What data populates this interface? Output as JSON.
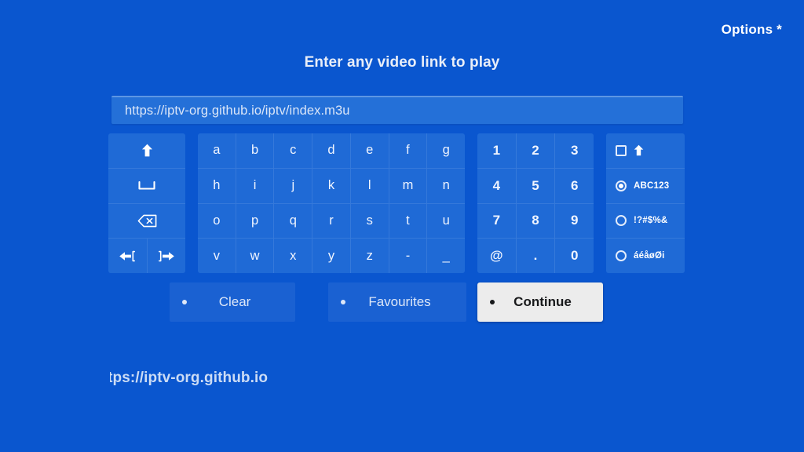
{
  "header": {
    "options_label": "Options *"
  },
  "main": {
    "title": "Enter any video link to play",
    "url_field": {
      "value": "https://iptv-org.github.io/iptv/index.m3u",
      "placeholder": "Enter any video link to play"
    }
  },
  "keyboard": {
    "function_keys": [
      {
        "name": "shift-key",
        "icon": "arrow-up-icon",
        "label": ""
      },
      {
        "name": "space-key",
        "icon": "space-bar-icon",
        "label": ""
      },
      {
        "name": "backspace-key",
        "icon": "backspace-icon",
        "label": ""
      },
      {
        "name": "cursor-left-key",
        "icon": "arrow-left-bracket-icon",
        "label": ""
      },
      {
        "name": "cursor-right-key",
        "icon": "bracket-arrow-right-icon",
        "label": ""
      }
    ],
    "letter_rows": [
      [
        "a",
        "b",
        "c",
        "d",
        "e",
        "f",
        "g"
      ],
      [
        "h",
        "i",
        "j",
        "k",
        "l",
        "m",
        "n"
      ],
      [
        "o",
        "p",
        "q",
        "r",
        "s",
        "t",
        "u"
      ],
      [
        "v",
        "w",
        "x",
        "y",
        "z",
        "-",
        "_"
      ]
    ],
    "digit_rows": [
      [
        "1",
        "2",
        "3"
      ],
      [
        "4",
        "5",
        "6"
      ],
      [
        "7",
        "8",
        "9"
      ],
      [
        "@",
        ".",
        "0"
      ]
    ],
    "mode_options": [
      {
        "type": "checkbox",
        "checked": false,
        "label": "",
        "icon": "shift-arrow-up-icon"
      },
      {
        "type": "radio",
        "checked": true,
        "label": "ABC123"
      },
      {
        "type": "radio",
        "checked": false,
        "label": "!?#$%&"
      },
      {
        "type": "radio",
        "checked": false,
        "label": "áéåøØi"
      }
    ]
  },
  "actions": {
    "clear_label": "Clear",
    "favourites_label": "Favourites",
    "continue_label": "Continue"
  },
  "footer": {
    "url_text": "https://iptv-org.github.io"
  },
  "colors": {
    "background": "#0a56cf",
    "panel": "#1f6ad6",
    "input": "#2470d8",
    "input_border_top": "#5d96e4",
    "text": "#ffffff",
    "muted_text": "#dde7f8",
    "focus_button_bg": "#ececec",
    "focus_button_text": "#17181a"
  }
}
